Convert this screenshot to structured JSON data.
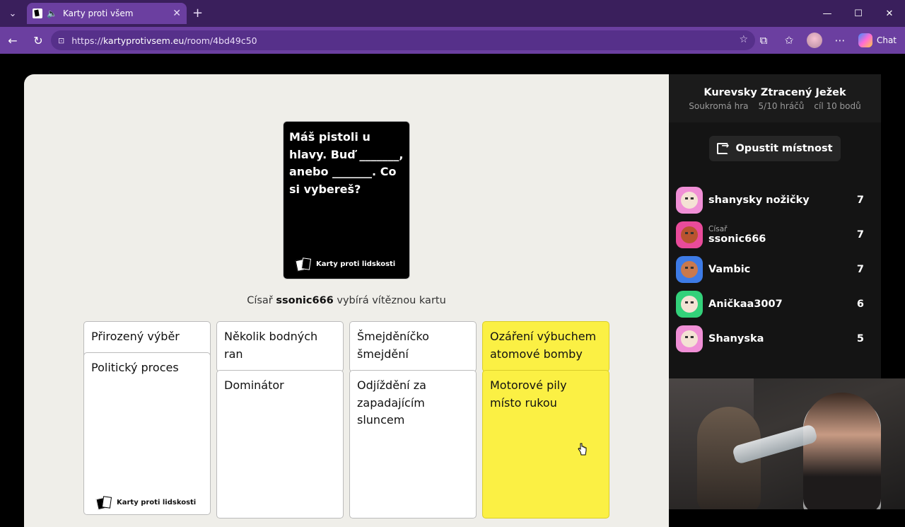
{
  "browser": {
    "tab_title": "Karty proti všem",
    "url_scheme": "https://",
    "url_host": "kartyprotivsem.eu",
    "url_path": "/room/4bd49c50",
    "chat_label": "Chat"
  },
  "game": {
    "black_card": {
      "text": "Máš pistoli u hlavy. Buď _______, anebo _______. Co si vybereš?",
      "brand": "Karty proti lidskosti"
    },
    "status": {
      "prefix": "Císař",
      "czar": "ssonic666",
      "suffix": "vybírá vítěznou kartu"
    },
    "white_cards": [
      {
        "text": "Přirozený výběr",
        "color": "#ffffff"
      },
      {
        "text": "Politický proces",
        "color": "#ffffff",
        "brand": "Karty proti lidskosti"
      },
      {
        "text": "Několik bodných ran",
        "color": "#ffffff"
      },
      {
        "text": "Dominátor",
        "color": "#ffffff"
      },
      {
        "text": "Šmejděníčko šmejdění",
        "color": "#ffffff"
      },
      {
        "text": "Odjíždění za zapadajícím sluncem",
        "color": "#ffffff"
      },
      {
        "text": "Ozáření výbuchem atomové bomby",
        "color": "#fbf044"
      },
      {
        "text": "Motorové pily místo rukou",
        "color": "#fbf044"
      }
    ]
  },
  "sidebar": {
    "room_name": "Kurevsky Ztracený Ježek",
    "meta": [
      "Soukromá hra",
      "5/10 hráčů",
      "cíl 10 bodů"
    ],
    "leave_label": "Opustit místnost",
    "players": [
      {
        "name": "shanysky nožičky",
        "role": "",
        "score": "7",
        "avatar_color": "#f08fd6"
      },
      {
        "name": "ssonic666",
        "role": "Císař",
        "score": "7",
        "avatar_color": "#e94b9a"
      },
      {
        "name": "Vambic",
        "role": "",
        "score": "7",
        "avatar_color": "#3d7be6"
      },
      {
        "name": "Aničkaa3007",
        "role": "",
        "score": "6",
        "avatar_color": "#33d17a"
      },
      {
        "name": "Shanyska",
        "role": "",
        "score": "5",
        "avatar_color": "#f08fd6"
      }
    ]
  }
}
